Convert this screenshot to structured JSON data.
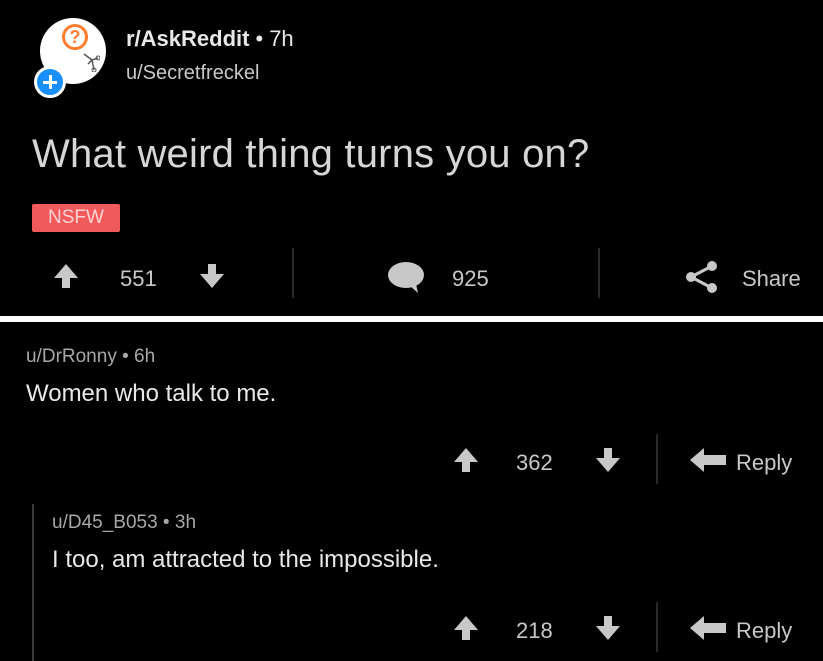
{
  "post": {
    "subreddit": "r/AskReddit",
    "age": "7h",
    "author": "u/Secretfreckel",
    "title": "What weird thing turns you on?",
    "tag": "NSFW",
    "votes": "551",
    "comments": "925",
    "share_label": "Share"
  },
  "comments": [
    {
      "author": "u/DrRonny",
      "age": "6h",
      "body": "Women who talk to me.",
      "votes": "362",
      "reply_label": "Reply"
    },
    {
      "author": "u/D45_B053",
      "age": "3h",
      "body": "I too, am attracted to the impossible.",
      "votes": "218",
      "reply_label": "Reply"
    }
  ],
  "colors": {
    "nsfw": "#f05a5a",
    "join_badge": "#1a8fff",
    "background": "#000000"
  }
}
